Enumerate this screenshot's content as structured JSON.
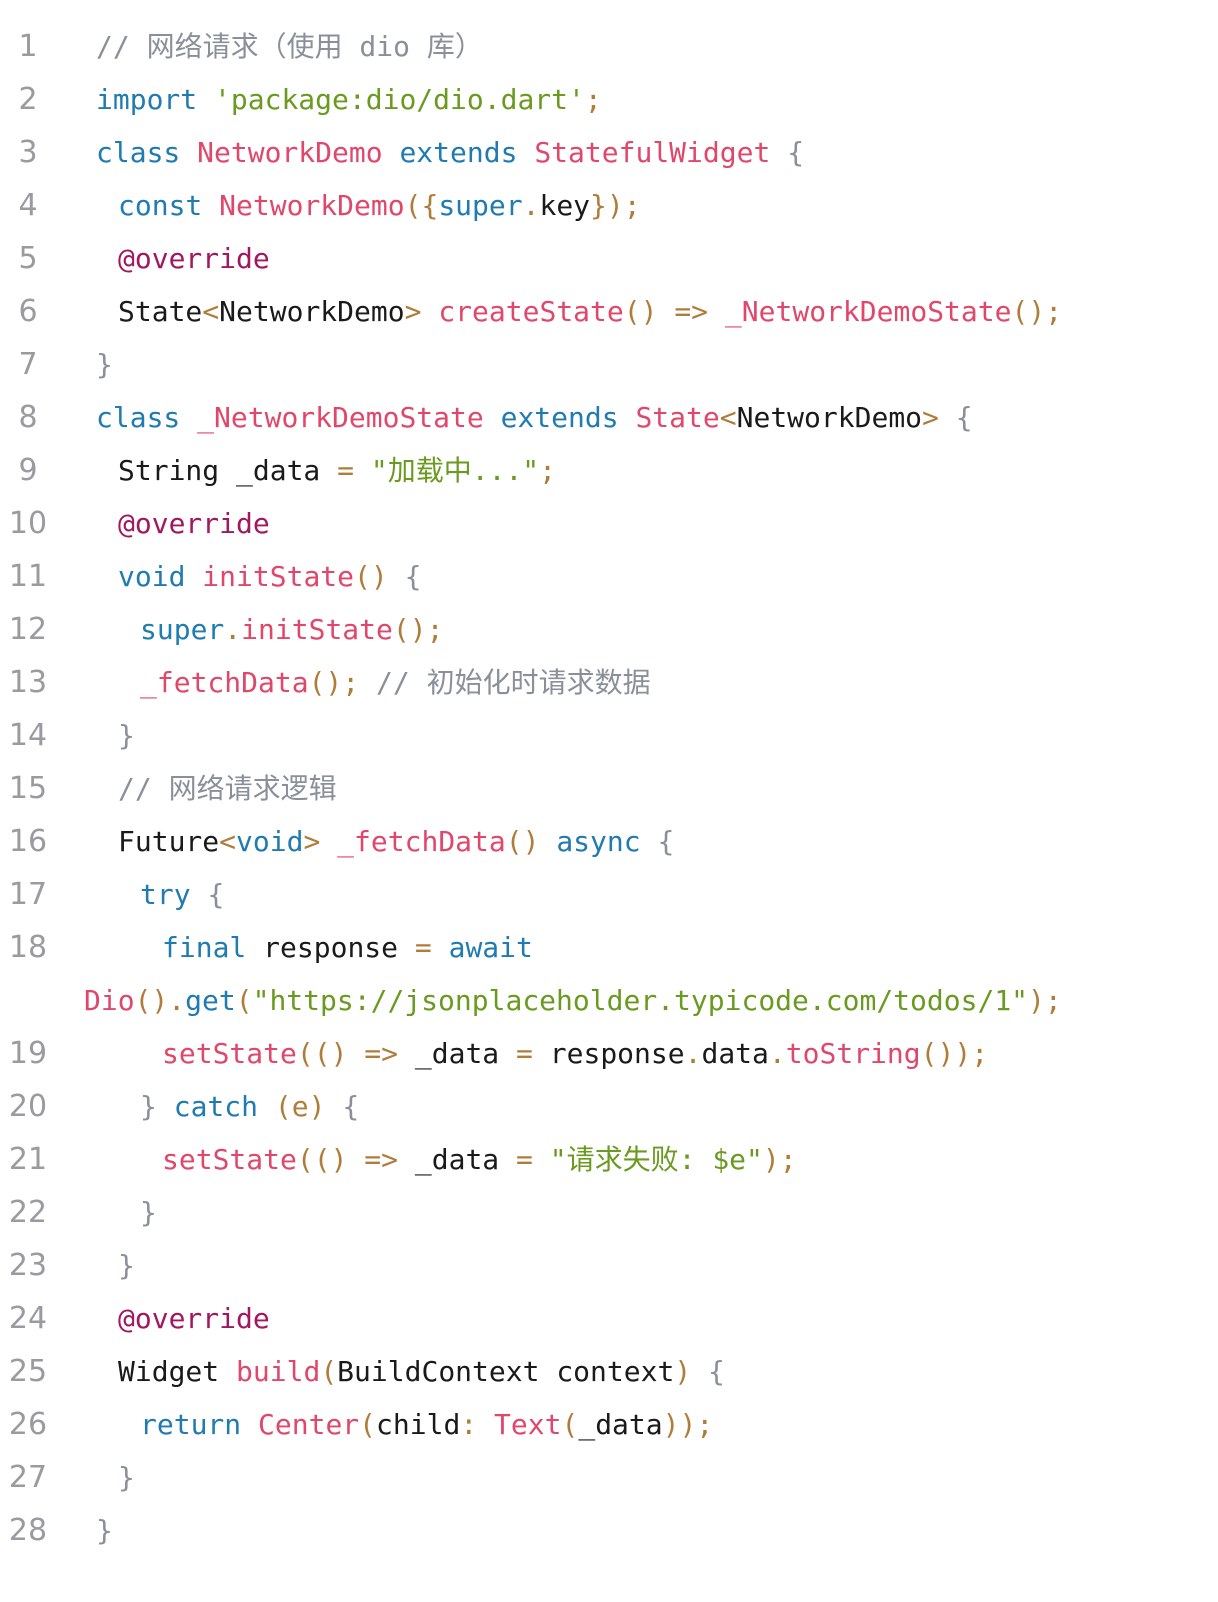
{
  "colors": {
    "keyword": "#1f7bb0",
    "type_class": "#e0476a",
    "string": "#6a9a1f",
    "annotation": "#a1185f",
    "comment": "#8a8f99",
    "punctuation": "#b07c3a",
    "plain": "#1a1a1a",
    "line_number": "#9a9aa0"
  },
  "lines": [
    {
      "num": "1",
      "indent": 0,
      "tokens": [
        {
          "t": "// 网络请求（使用 dio 库）",
          "c": "comment"
        }
      ]
    },
    {
      "num": "2",
      "indent": 0,
      "tokens": [
        {
          "t": "import ",
          "c": "keyword"
        },
        {
          "t": "'package:dio/dio.dart'",
          "c": "string"
        },
        {
          "t": ";",
          "c": "punctuation"
        }
      ]
    },
    {
      "num": "3",
      "indent": 0,
      "tokens": [
        {
          "t": "class ",
          "c": "keyword"
        },
        {
          "t": "NetworkDemo ",
          "c": "type_class"
        },
        {
          "t": "extends ",
          "c": "keyword"
        },
        {
          "t": "StatefulWidget ",
          "c": "type_class"
        },
        {
          "t": "{",
          "c": "comment"
        }
      ]
    },
    {
      "num": "4",
      "indent": 1,
      "tokens": [
        {
          "t": "const ",
          "c": "keyword"
        },
        {
          "t": "NetworkDemo",
          "c": "type_class"
        },
        {
          "t": "({",
          "c": "punctuation"
        },
        {
          "t": "super",
          "c": "keyword"
        },
        {
          "t": ".",
          "c": "punctuation"
        },
        {
          "t": "key",
          "c": "plain"
        },
        {
          "t": "});",
          "c": "punctuation"
        }
      ]
    },
    {
      "num": "5",
      "indent": 1,
      "tokens": [
        {
          "t": "@override",
          "c": "annotation"
        }
      ]
    },
    {
      "num": "6",
      "indent": 1,
      "tokens": [
        {
          "t": "State",
          "c": "plain"
        },
        {
          "t": "<",
          "c": "punctuation"
        },
        {
          "t": "NetworkDemo",
          "c": "plain"
        },
        {
          "t": "> ",
          "c": "punctuation"
        },
        {
          "t": "createState",
          "c": "type_class"
        },
        {
          "t": "() => ",
          "c": "punctuation"
        },
        {
          "t": "_NetworkDemoState",
          "c": "type_class"
        },
        {
          "t": "();",
          "c": "punctuation"
        }
      ]
    },
    {
      "num": "7",
      "indent": 0,
      "tokens": [
        {
          "t": "}",
          "c": "comment"
        }
      ]
    },
    {
      "num": "8",
      "indent": 0,
      "tokens": [
        {
          "t": "class ",
          "c": "keyword"
        },
        {
          "t": "_NetworkDemoState ",
          "c": "type_class"
        },
        {
          "t": "extends ",
          "c": "keyword"
        },
        {
          "t": "State",
          "c": "type_class"
        },
        {
          "t": "<",
          "c": "punctuation"
        },
        {
          "t": "NetworkDemo",
          "c": "plain"
        },
        {
          "t": "> ",
          "c": "punctuation"
        },
        {
          "t": "{",
          "c": "comment"
        }
      ]
    },
    {
      "num": "9",
      "indent": 1,
      "tokens": [
        {
          "t": "String _data ",
          "c": "plain"
        },
        {
          "t": "= ",
          "c": "punctuation"
        },
        {
          "t": "\"加载中...\"",
          "c": "string"
        },
        {
          "t": ";",
          "c": "punctuation"
        }
      ]
    },
    {
      "num": "10",
      "indent": 1,
      "tokens": [
        {
          "t": "@override",
          "c": "annotation"
        }
      ]
    },
    {
      "num": "11",
      "indent": 1,
      "tokens": [
        {
          "t": "void ",
          "c": "keyword"
        },
        {
          "t": "initState",
          "c": "type_class"
        },
        {
          "t": "() ",
          "c": "punctuation"
        },
        {
          "t": "{",
          "c": "comment"
        }
      ]
    },
    {
      "num": "12",
      "indent": 2,
      "tokens": [
        {
          "t": "super",
          "c": "keyword"
        },
        {
          "t": ".",
          "c": "punctuation"
        },
        {
          "t": "initState",
          "c": "type_class"
        },
        {
          "t": "();",
          "c": "punctuation"
        }
      ]
    },
    {
      "num": "13",
      "indent": 2,
      "tokens": [
        {
          "t": "_fetchData",
          "c": "type_class"
        },
        {
          "t": "(); ",
          "c": "punctuation"
        },
        {
          "t": "// 初始化时请求数据",
          "c": "comment"
        }
      ]
    },
    {
      "num": "14",
      "indent": 1,
      "tokens": [
        {
          "t": "}",
          "c": "comment"
        }
      ]
    },
    {
      "num": "15",
      "indent": 1,
      "tokens": [
        {
          "t": "// 网络请求逻辑",
          "c": "comment"
        }
      ]
    },
    {
      "num": "16",
      "indent": 1,
      "tokens": [
        {
          "t": "Future",
          "c": "plain"
        },
        {
          "t": "<",
          "c": "punctuation"
        },
        {
          "t": "void",
          "c": "keyword"
        },
        {
          "t": "> ",
          "c": "punctuation"
        },
        {
          "t": "_fetchData",
          "c": "type_class"
        },
        {
          "t": "() ",
          "c": "punctuation"
        },
        {
          "t": "async ",
          "c": "keyword"
        },
        {
          "t": "{",
          "c": "comment"
        }
      ]
    },
    {
      "num": "17",
      "indent": 2,
      "tokens": [
        {
          "t": "try ",
          "c": "keyword"
        },
        {
          "t": "{",
          "c": "comment"
        }
      ]
    },
    {
      "num": "18",
      "indent": 3,
      "tokens": [
        {
          "t": "final ",
          "c": "keyword"
        },
        {
          "t": "response ",
          "c": "plain"
        },
        {
          "t": "= ",
          "c": "punctuation"
        },
        {
          "t": "await",
          "c": "keyword"
        }
      ]
    },
    {
      "num": "",
      "indent": -1,
      "tokens": [
        {
          "t": "Dio",
          "c": "type_class"
        },
        {
          "t": "().",
          "c": "punctuation"
        },
        {
          "t": "get",
          "c": "keyword"
        },
        {
          "t": "(",
          "c": "punctuation"
        },
        {
          "t": "\"https://jsonplaceholder.typicode.com/todos/1\"",
          "c": "string"
        },
        {
          "t": ");",
          "c": "punctuation"
        }
      ]
    },
    {
      "num": "19",
      "indent": 3,
      "tokens": [
        {
          "t": "setState",
          "c": "type_class"
        },
        {
          "t": "(() => ",
          "c": "punctuation"
        },
        {
          "t": "_data ",
          "c": "plain"
        },
        {
          "t": "= ",
          "c": "punctuation"
        },
        {
          "t": "response",
          "c": "plain"
        },
        {
          "t": ".",
          "c": "punctuation"
        },
        {
          "t": "data",
          "c": "plain"
        },
        {
          "t": ".",
          "c": "punctuation"
        },
        {
          "t": "toString",
          "c": "type_class"
        },
        {
          "t": "());",
          "c": "punctuation"
        }
      ]
    },
    {
      "num": "20",
      "indent": 2,
      "tokens": [
        {
          "t": "} ",
          "c": "comment"
        },
        {
          "t": "catch ",
          "c": "keyword"
        },
        {
          "t": "(e) ",
          "c": "punctuation"
        },
        {
          "t": "{",
          "c": "comment"
        }
      ]
    },
    {
      "num": "21",
      "indent": 3,
      "tokens": [
        {
          "t": "setState",
          "c": "type_class"
        },
        {
          "t": "(() => ",
          "c": "punctuation"
        },
        {
          "t": "_data ",
          "c": "plain"
        },
        {
          "t": "= ",
          "c": "punctuation"
        },
        {
          "t": "\"请求失败: $e\"",
          "c": "string"
        },
        {
          "t": ");",
          "c": "punctuation"
        }
      ]
    },
    {
      "num": "22",
      "indent": 2,
      "tokens": [
        {
          "t": "}",
          "c": "comment"
        }
      ]
    },
    {
      "num": "23",
      "indent": 1,
      "tokens": [
        {
          "t": "}",
          "c": "comment"
        }
      ]
    },
    {
      "num": "24",
      "indent": 1,
      "tokens": [
        {
          "t": "@override",
          "c": "annotation"
        }
      ]
    },
    {
      "num": "25",
      "indent": 1,
      "tokens": [
        {
          "t": "Widget ",
          "c": "plain"
        },
        {
          "t": "build",
          "c": "type_class"
        },
        {
          "t": "(",
          "c": "punctuation"
        },
        {
          "t": "BuildContext context",
          "c": "plain"
        },
        {
          "t": ") ",
          "c": "punctuation"
        },
        {
          "t": "{",
          "c": "comment"
        }
      ]
    },
    {
      "num": "26",
      "indent": 2,
      "tokens": [
        {
          "t": "return ",
          "c": "keyword"
        },
        {
          "t": "Center",
          "c": "type_class"
        },
        {
          "t": "(",
          "c": "punctuation"
        },
        {
          "t": "child",
          "c": "plain"
        },
        {
          "t": ": ",
          "c": "punctuation"
        },
        {
          "t": "Text",
          "c": "type_class"
        },
        {
          "t": "(",
          "c": "punctuation"
        },
        {
          "t": "_data",
          "c": "plain"
        },
        {
          "t": "));",
          "c": "punctuation"
        }
      ]
    },
    {
      "num": "27",
      "indent": 1,
      "tokens": [
        {
          "t": "}",
          "c": "comment"
        }
      ]
    },
    {
      "num": "28",
      "indent": 0,
      "tokens": [
        {
          "t": "}",
          "c": "comment"
        }
      ]
    }
  ]
}
